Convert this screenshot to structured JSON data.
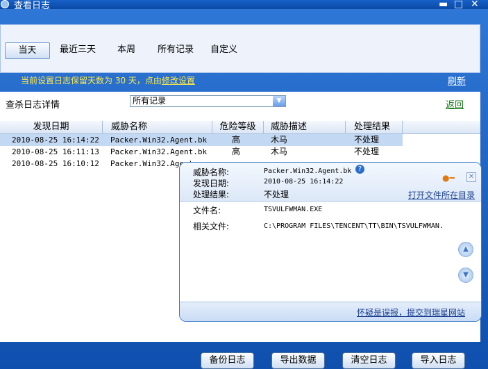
{
  "window": {
    "title": "查看日志",
    "minimize": "▬",
    "maximize": "□",
    "close": "✕"
  },
  "tabs": [
    {
      "label": "当天",
      "active": true
    },
    {
      "label": "最近三天"
    },
    {
      "label": "本周"
    },
    {
      "label": "所有记录"
    },
    {
      "label": "自定义"
    }
  ],
  "info": {
    "prefix": "当前设置日志保留天数为 30 天，点由",
    "link": "修改设置",
    "refresh": "刷新"
  },
  "filter": {
    "label": "查杀日志详情",
    "selected": "所有记录",
    "back": "返回"
  },
  "table": {
    "headers": [
      "发现日期",
      "威胁名称",
      "危险等级",
      "威胁描述",
      "处理结果"
    ],
    "rows": [
      {
        "date": "2010-08-25 16:14:22",
        "name": "Packer.Win32.Agent.bk",
        "level": "高",
        "desc": "木马",
        "result": "不处理"
      },
      {
        "date": "2010-08-25 16:11:13",
        "name": "Packer.Win32.Agent.bk",
        "level": "高",
        "desc": "木马",
        "result": "不处理"
      },
      {
        "date": "2010-08-25 16:10:12",
        "name": "Packer.Win32.Agent",
        "level": "",
        "desc": "",
        "result": ""
      }
    ]
  },
  "popup": {
    "threat_name_label": "威胁名称:",
    "threat_name": "Packer.Win32.Agent.bk",
    "date_label": "发现日期:",
    "date": "2010-08-25 16:14:22",
    "result_label": "处理结果:",
    "result": "不处理",
    "open_folder": "打开文件所在目录",
    "file_label": "文件名:",
    "file": "TSVULFWMAN.EXE",
    "related_label": "相关文件:",
    "related": "C:\\PROGRAM FILES\\TENCENT\\TT\\BIN\\TSVULFWMAN.",
    "report": "怀疑是误报，提交到瑞星网站"
  },
  "footer": [
    "备份日志",
    "导出数据",
    "清空日志",
    "导入日志"
  ]
}
